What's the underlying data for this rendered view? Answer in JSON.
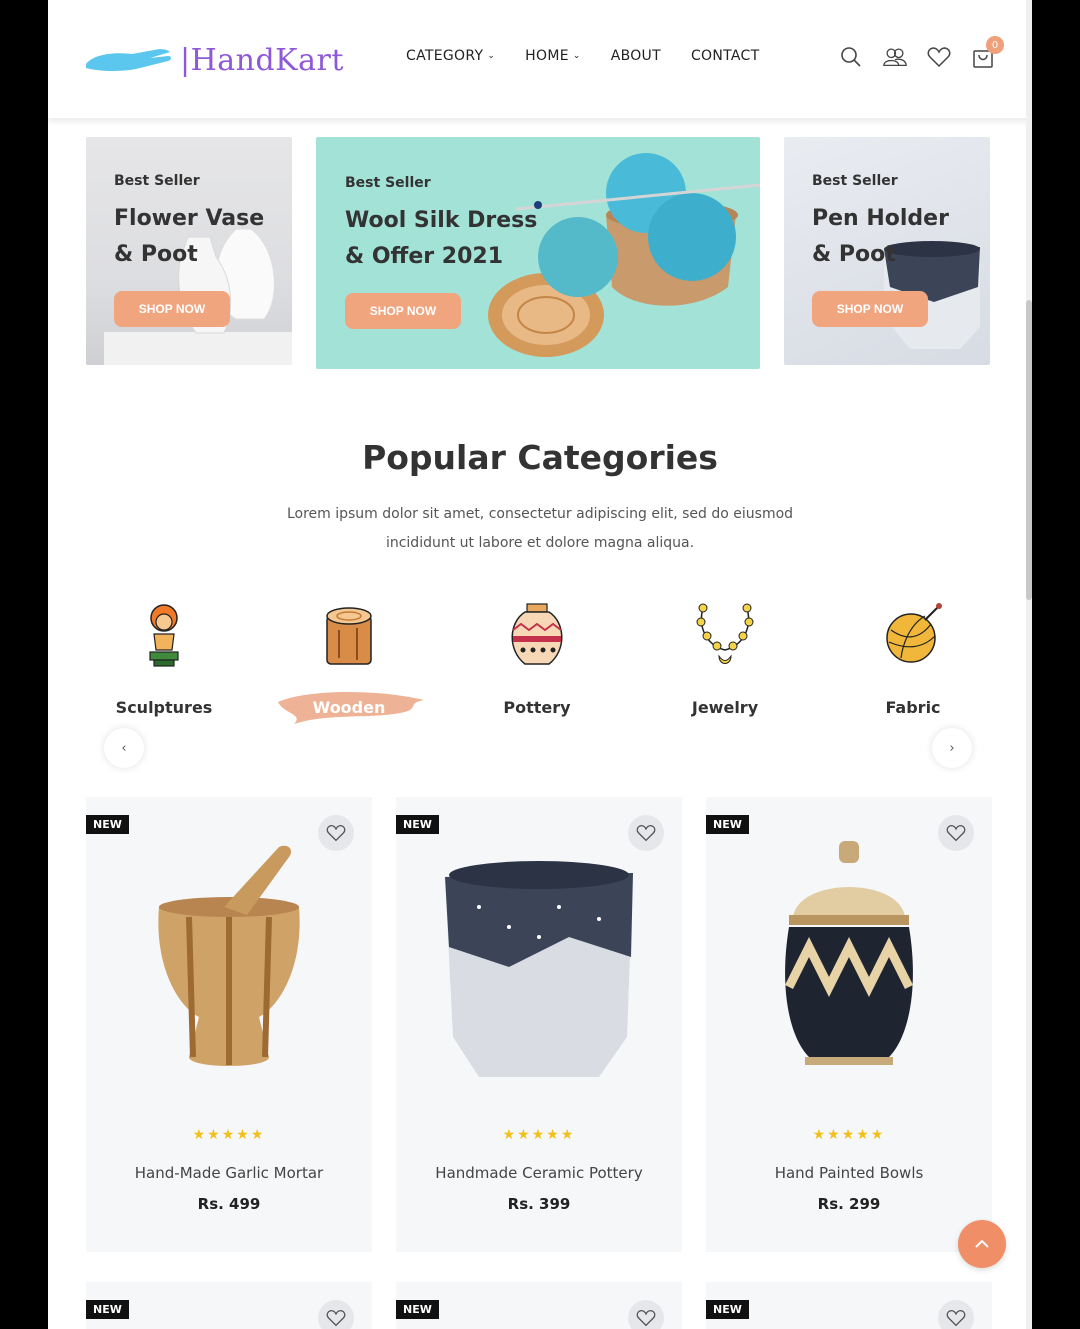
{
  "header": {
    "logo_text": "|HandKart",
    "nav": [
      {
        "label": "CATEGORY",
        "dropdown": true
      },
      {
        "label": "HOME",
        "dropdown": true
      },
      {
        "label": "ABOUT",
        "dropdown": false
      },
      {
        "label": "CONTACT",
        "dropdown": false
      }
    ],
    "icons": [
      "search-icon",
      "users-icon",
      "heart-icon",
      "cart-icon"
    ],
    "cart_count": "0"
  },
  "banners": [
    {
      "kicker": "Best Seller",
      "title_line1": "Flower Vase",
      "title_line2": "& Poot",
      "button": "SHOP NOW"
    },
    {
      "kicker": "Best Seller",
      "title_line1": "Wool Silk Dress",
      "title_line2": "& Offer 2021",
      "button": "SHOP NOW"
    },
    {
      "kicker": "Best Seller",
      "title_line1": "Pen Holder",
      "title_line2": "& Poot",
      "button": "SHOP NOW"
    }
  ],
  "popular": {
    "title": "Popular Categories",
    "desc_line1": "Lorem ipsum dolor sit amet, consectetur adipiscing elit, sed do eiusmod",
    "desc_line2": "incididunt ut labore et dolore magna aliqua."
  },
  "categories": [
    {
      "label": "Sculptures",
      "icon": "sculpture-icon"
    },
    {
      "label": "Wooden",
      "icon": "wood-log-icon",
      "active": true
    },
    {
      "label": "Pottery",
      "icon": "pottery-icon"
    },
    {
      "label": "Jewelry",
      "icon": "jewelry-icon"
    },
    {
      "label": "Fabric",
      "icon": "yarn-icon"
    }
  ],
  "carousel": {
    "prev": "‹",
    "next": "›"
  },
  "products": [
    {
      "badge": "NEW",
      "rating": "★★★★★",
      "name": "Hand-Made Garlic Mortar",
      "price": "Rs. 499"
    },
    {
      "badge": "NEW",
      "rating": "★★★★★",
      "name": "Handmade Ceramic Pottery",
      "price": "Rs. 399"
    },
    {
      "badge": "NEW",
      "rating": "★★★★★",
      "name": "Hand Painted Bowls",
      "price": "Rs. 299"
    }
  ],
  "products_row2": [
    {
      "badge": "NEW"
    },
    {
      "badge": "NEW"
    },
    {
      "badge": "NEW"
    }
  ],
  "colors": {
    "accent": "#f0a57f",
    "brand": "#8e58d9",
    "banner_teal": "#a3e3d7"
  }
}
